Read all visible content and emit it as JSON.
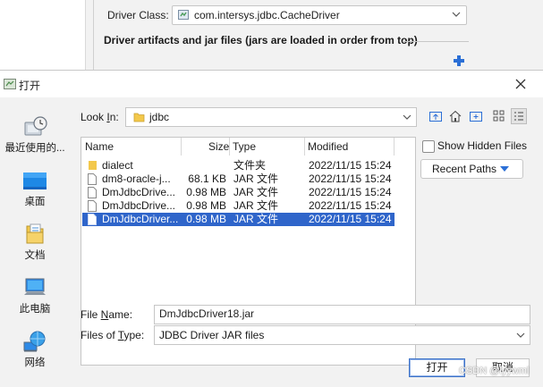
{
  "background_dialog": {
    "driver_class_label": "Driver Class:",
    "driver_class_value": "com.intersys.jdbc.CacheDriver",
    "artifacts_title": "Driver artifacts and jar files (jars are loaded in order from top)"
  },
  "dialog": {
    "title": "打开",
    "places": [
      {
        "label": "最近使用的...",
        "icon": "recent-icon"
      },
      {
        "label": "桌面",
        "icon": "desktop-icon"
      },
      {
        "label": "文档",
        "icon": "documents-icon"
      },
      {
        "label": "此电脑",
        "icon": "computer-icon"
      },
      {
        "label": "网络",
        "icon": "network-icon"
      }
    ],
    "look_in": {
      "label_pre": "Look ",
      "label_mnemonic": "I",
      "label_post": "n:",
      "value": "jdbc"
    },
    "columns": {
      "name": "Name",
      "size": "Size",
      "type": "Type",
      "modified": "Modified"
    },
    "files": [
      {
        "name": "dialect",
        "size": "",
        "type": "文件夹",
        "modified": "2022/11/15 15:24",
        "kind": "folder",
        "selected": false
      },
      {
        "name": "dm8-oracle-j...",
        "size": "68.1 KB",
        "type": "JAR 文件",
        "modified": "2022/11/15 15:24",
        "kind": "file",
        "selected": false
      },
      {
        "name": "DmJdbcDrive...",
        "size": "0.98 MB",
        "type": "JAR 文件",
        "modified": "2022/11/15 15:24",
        "kind": "file",
        "selected": false
      },
      {
        "name": "DmJdbcDrive...",
        "size": "0.98 MB",
        "type": "JAR 文件",
        "modified": "2022/11/15 15:24",
        "kind": "file",
        "selected": false
      },
      {
        "name": "DmJdbcDriver...",
        "size": "0.98 MB",
        "type": "JAR 文件",
        "modified": "2022/11/15 15:24",
        "kind": "file",
        "selected": true
      }
    ],
    "show_hidden_label": "Show Hidden Files",
    "recent_paths_label": "Recent Paths",
    "file_name": {
      "label_pre": "File ",
      "label_mnemonic": "N",
      "label_post": "ame:",
      "value": "DmJdbcDriver18.jar"
    },
    "file_type": {
      "label_pre": "Files of ",
      "label_mnemonic": "T",
      "label_post": "ype:",
      "value": "JDBC Driver JAR files"
    },
    "open_label": "打开",
    "cancel_label": "取消",
    "watermark": "CSDN @lyywml"
  },
  "colors": {
    "selection": "#2f65ca",
    "accent": "#2b6fd6"
  }
}
